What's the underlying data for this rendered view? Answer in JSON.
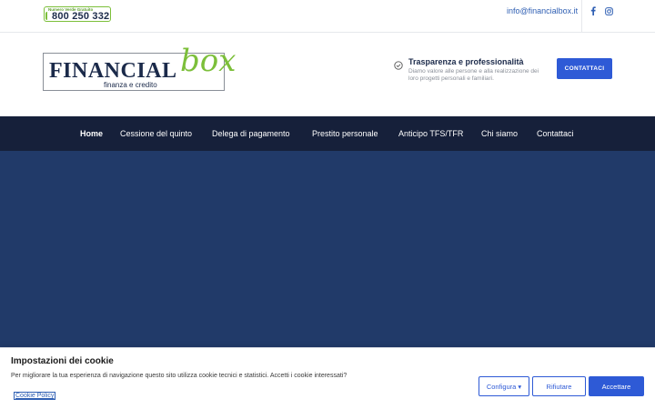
{
  "topbar": {
    "phone_badge_small": "Numero Verde Gratuito",
    "phone_number": "800 250 332",
    "email": "info@financialbox.it",
    "social_icons": [
      "facebook-icon",
      "instagram-icon"
    ]
  },
  "header": {
    "logo_main": "FINANCIAL",
    "logo_box": "box",
    "logo_sub": "finanza e credito",
    "trust_title": "Trasparenza e professionalità",
    "trust_text": "Diamo valore alle persone e alla realizzazione dei loro progetti personali e familiari.",
    "contact_button": "CONTATTACI"
  },
  "nav": {
    "items": [
      {
        "label": "Home"
      },
      {
        "label": "Cessione del quinto"
      },
      {
        "label": "Delega di pagamento"
      },
      {
        "label": "Prestito personale"
      },
      {
        "label": "Anticipo TFS/TFR"
      },
      {
        "label": "Chi siamo"
      },
      {
        "label": "Contattaci"
      }
    ]
  },
  "cookie": {
    "title": "Impostazioni dei cookie",
    "text": "Per migliorare la tua esperienza di navigazione questo sito utilizza cookie tecnici e statistici. Accetti i cookie interessati?",
    "policy_link": "Cookie Policy",
    "configure_button": "Configura ▾",
    "reject_button": "Rifiutare",
    "accept_button": "Accettare"
  },
  "colors": {
    "brand_navy": "#1b2a4a",
    "brand_green": "#7cbf3a",
    "accent_blue": "#2e5ad6",
    "nav_bg": "#16203a",
    "hero_bg": "#213a69"
  }
}
